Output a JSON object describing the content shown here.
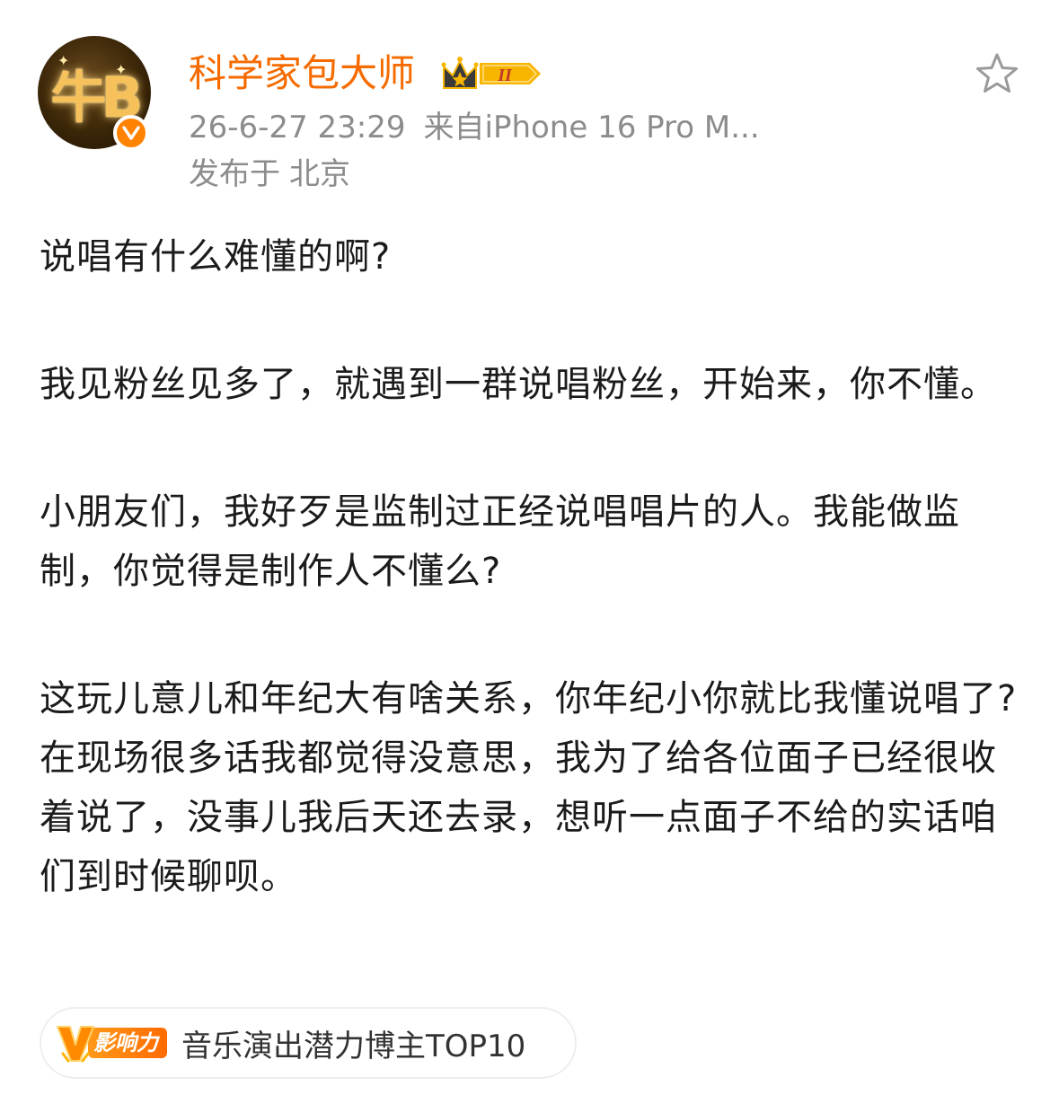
{
  "user": {
    "name": "科学家包大师",
    "avatar_glyph": "牛B",
    "vip_level": "II",
    "verified": true
  },
  "post_meta": {
    "time": "26-6-27 23:29",
    "source": "来自iPhone 16 Pro M...",
    "location_prefix": "发布于",
    "location": "北京"
  },
  "post": {
    "paragraphs": [
      "说唱有什么难懂的啊?",
      "我见粉丝见多了，就遇到一群说唱粉丝，开始来，你不懂。",
      "小朋友们，我好歹是监制过正经说唱唱片的人。我能做监制，你觉得是制作人不懂么?",
      "这玩儿意儿和年纪大有啥关系，你年纪小你就比我懂说唱了?在现场很多话我都觉得没意思，我为了给各位面子已经很收着说了，没事儿我后天还去录，想听一点面子不给的实话咱们到时候聊呗。"
    ]
  },
  "influence": {
    "badge_label": "影响力",
    "text": "音乐演出潜力博主TOP10"
  },
  "colors": {
    "username": "#f56b00",
    "meta": "#8c8c8c",
    "accent": "#ff8200",
    "vip_gold": "#f7b500"
  },
  "icons": {
    "star": "star-outline-icon",
    "verified": "verified-v-icon",
    "vip": "vip-crown-icon",
    "influence": "influence-v-icon"
  }
}
